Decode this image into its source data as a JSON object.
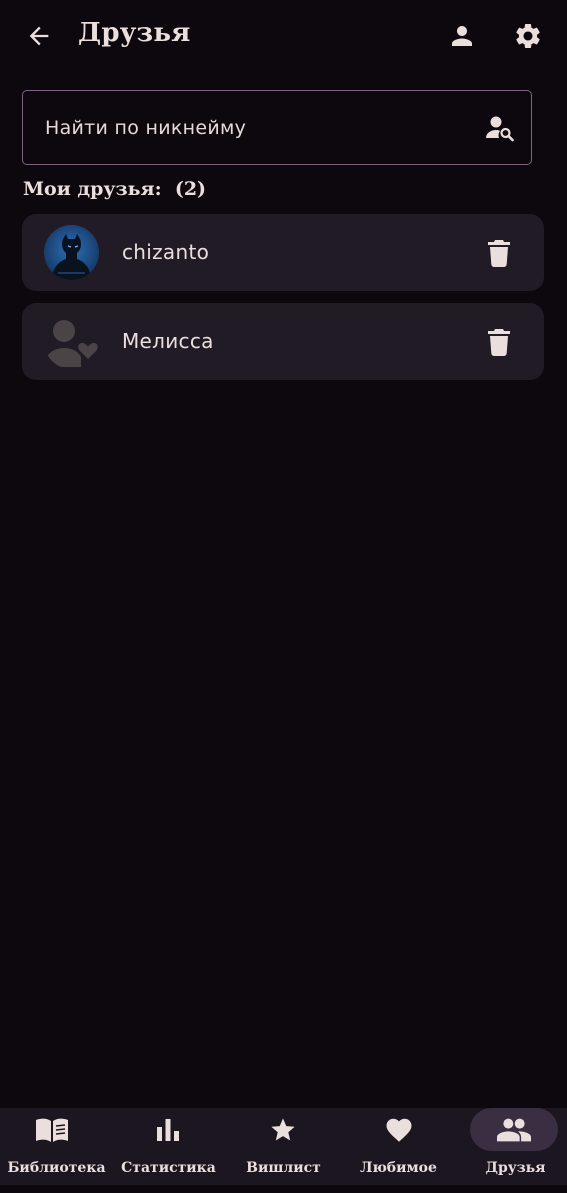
{
  "header": {
    "title": "Друзья",
    "back_icon": "arrow-back-icon",
    "profile_icon": "person-icon",
    "settings_icon": "gear-icon"
  },
  "search": {
    "placeholder": "Найти по никнейму",
    "value": "",
    "icon": "person-search-icon"
  },
  "friends_section": {
    "label": "Мои друзья:",
    "count": "(2)"
  },
  "friends": [
    {
      "name": "chizanto",
      "avatar": "photo-avatar",
      "delete_icon": "trash-icon"
    },
    {
      "name": "Мелисса",
      "avatar": "default-person-heart-avatar",
      "delete_icon": "trash-icon"
    }
  ],
  "bottom_nav": {
    "items": [
      {
        "label": "Библиотека",
        "icon": "book-icon",
        "active": false
      },
      {
        "label": "Статистика",
        "icon": "bar-chart-icon",
        "active": false
      },
      {
        "label": "Вишлист",
        "icon": "star-icon",
        "active": false
      },
      {
        "label": "Любимое",
        "icon": "heart-icon",
        "active": false
      },
      {
        "label": "Друзья",
        "icon": "people-icon",
        "active": true
      }
    ]
  },
  "colors": {
    "background": "#0c080d",
    "card": "#211b26",
    "accent_border": "#7b6583",
    "text": "#eadfdd",
    "nav_background": "#1c1620",
    "nav_active_pill": "#3a2f42"
  }
}
